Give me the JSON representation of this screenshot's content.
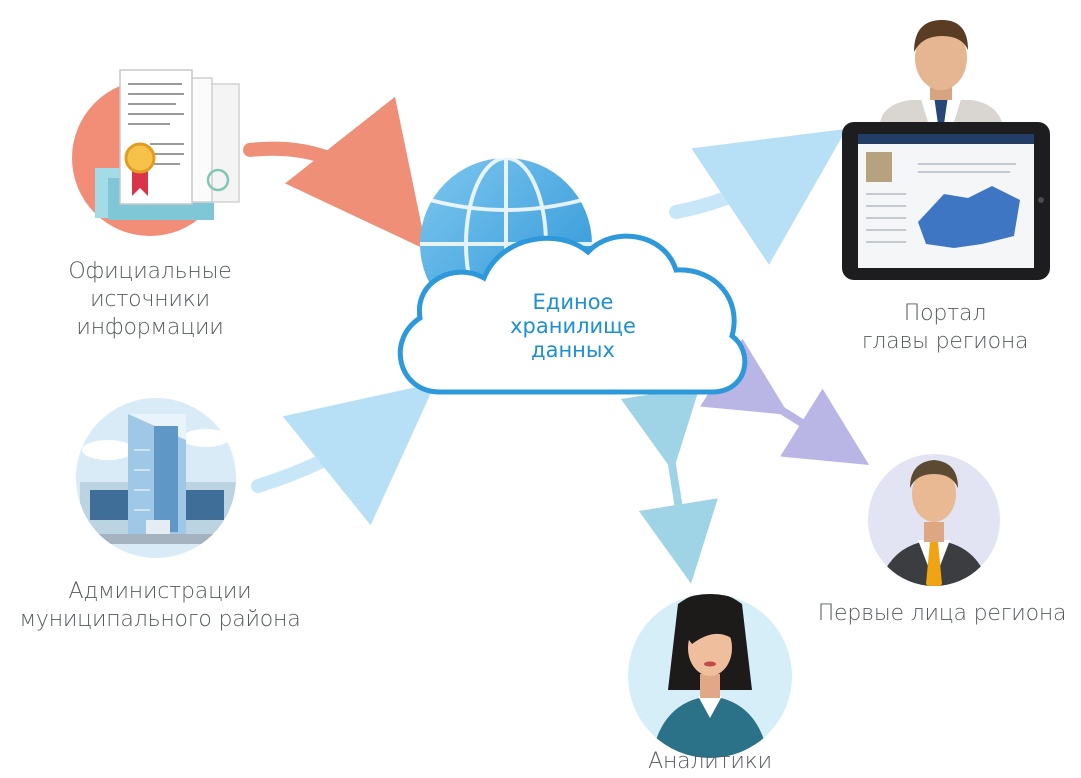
{
  "center": {
    "line1": "Единое",
    "line2": "хранилище",
    "line3": "данных"
  },
  "nodes": {
    "official_sources": {
      "line1": "Официальные",
      "line2": "источники",
      "line3": "информации"
    },
    "municipal_admin": {
      "line1": "Администрации",
      "line2": "муниципального района"
    },
    "portal": {
      "line1": "Портал",
      "line2": "главы региона"
    },
    "first_persons": {
      "line1": "Первые лица региона"
    },
    "analysts": {
      "line1": "Аналитики"
    }
  },
  "colors": {
    "accent_blue": "#1d8fd3",
    "arrow_orange": "#ef8f77",
    "arrow_light_blue": "#b7e0f7",
    "arrow_lavender": "#b9b6e6",
    "arrow_teal": "#9fd3e6"
  },
  "icons": {
    "official_sources": "documents-certificate-icon",
    "municipal_admin": "office-building-icon",
    "portal": "presenter-with-tablet-icon",
    "first_persons": "businessman-avatar-icon",
    "analysts": "female-analyst-avatar-icon",
    "center": "globe-cloud-icon"
  }
}
